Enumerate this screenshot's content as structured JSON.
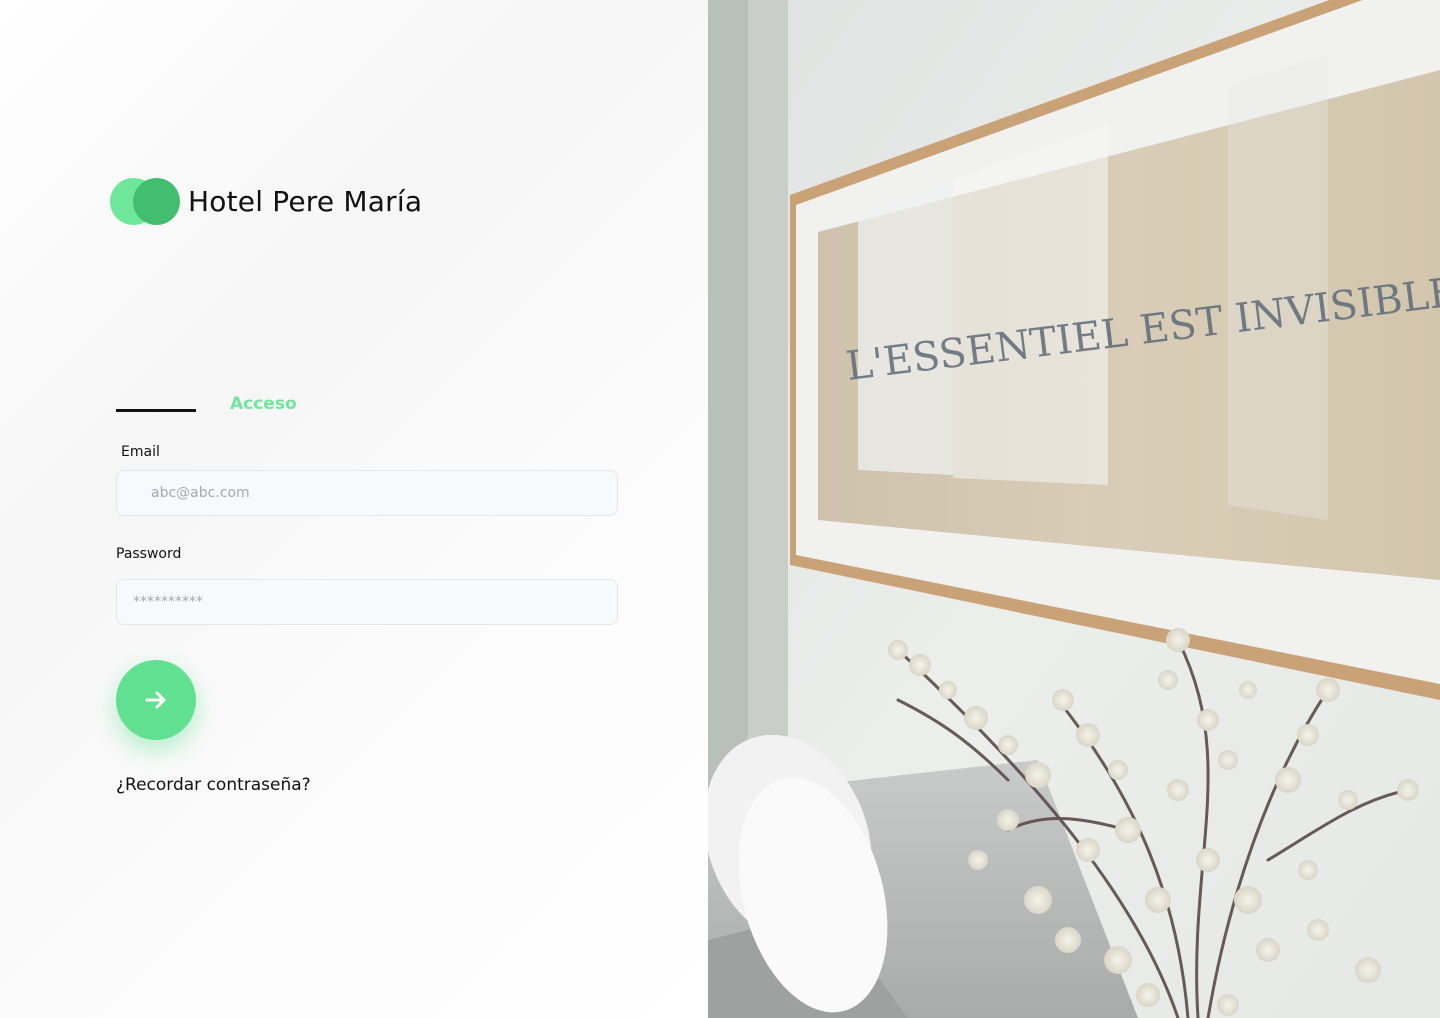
{
  "brand": {
    "name": "Hotel Pere María",
    "colors": {
      "light": "#6ee79a",
      "dark": "#43bd70"
    }
  },
  "tabs": {
    "active_label": "Acceso"
  },
  "form": {
    "email": {
      "label": "Email",
      "placeholder": "abc@abc.com"
    },
    "password": {
      "label": "Password",
      "placeholder": "**********"
    },
    "submit": {
      "icon": "arrow-right-icon"
    },
    "forgot_label": "¿Recordar contraseña?"
  },
  "photo": {
    "caption_text": "L'ESSENTIEL EST INVISIBLE POUR LES YEUX"
  },
  "accent_color": "#62e092"
}
